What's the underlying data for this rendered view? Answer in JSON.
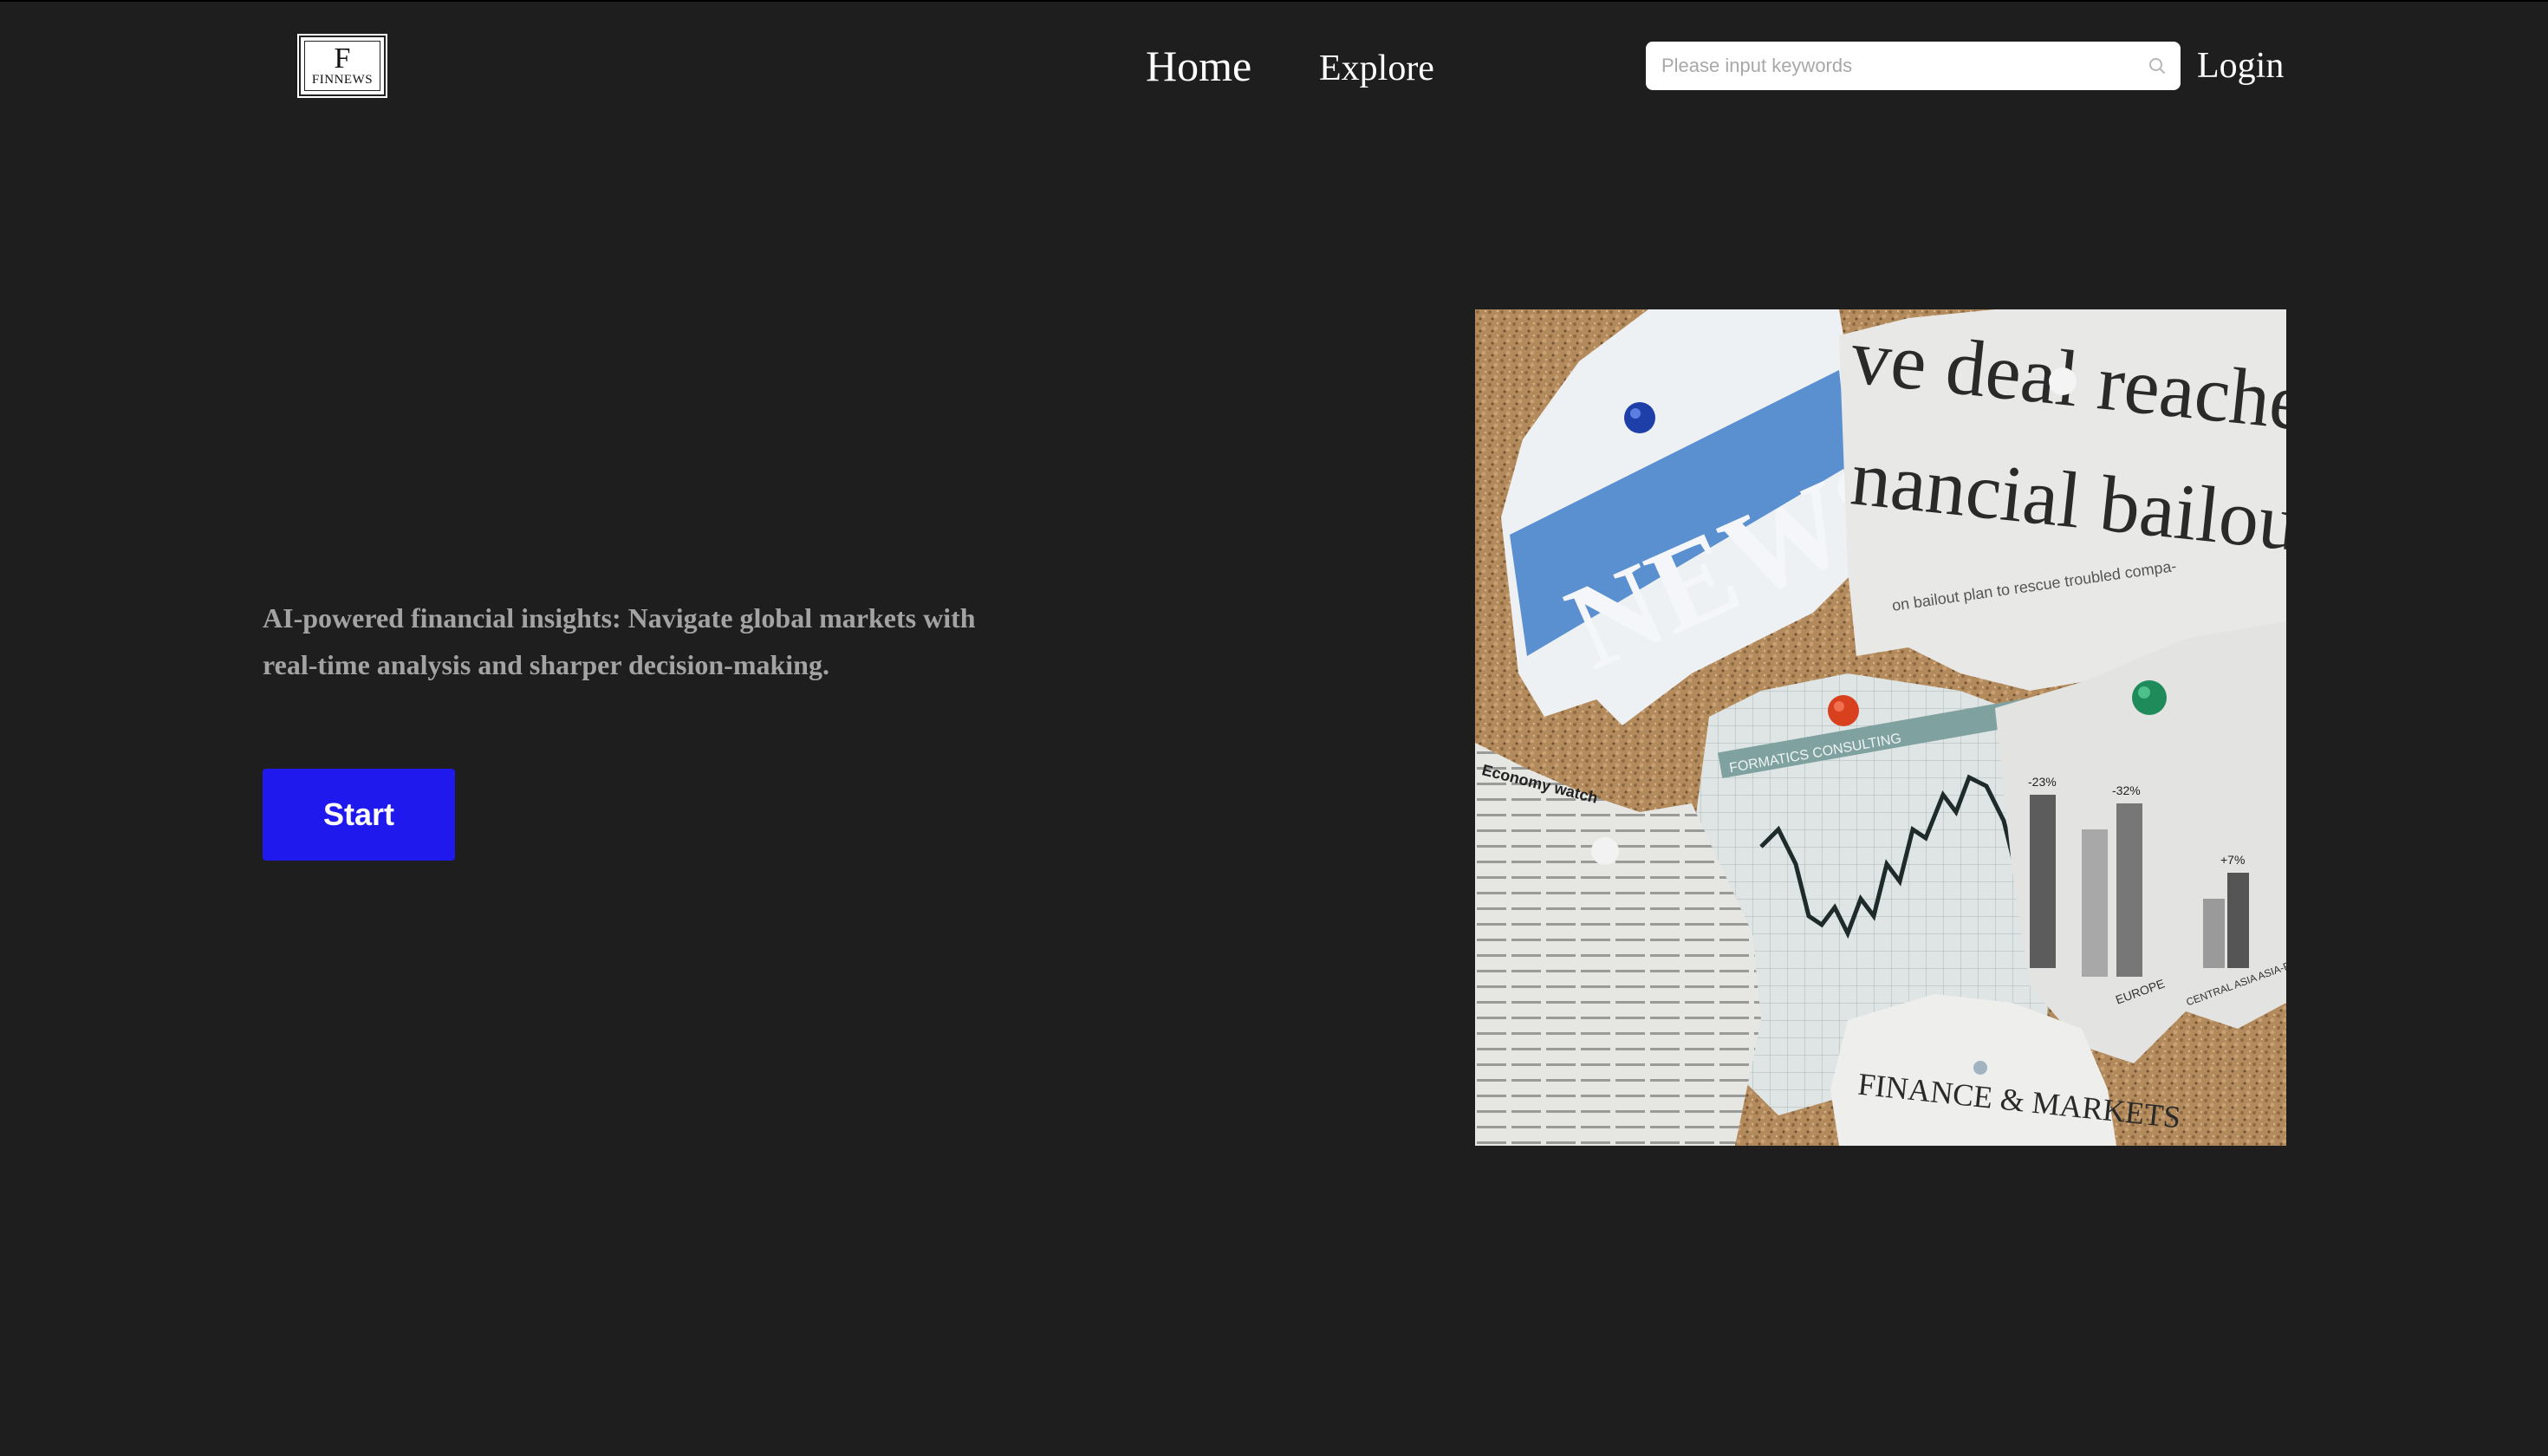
{
  "header": {
    "logo": {
      "letter": "F",
      "text": "FINNEWS"
    },
    "nav": {
      "home": "Home",
      "explore": "Explore"
    },
    "search": {
      "placeholder": "Please input keywords",
      "value": "",
      "icon": "search-icon"
    },
    "login": "Login"
  },
  "hero": {
    "tagline_line1": "AI-powered financial insights: Navigate global markets with",
    "tagline_line2": "real-time analysis and sharper decision-making.",
    "start_label": "Start",
    "image": {
      "news_word": "NEWS",
      "headline_line1": "ve deal reached",
      "headline_line2": "nancial bailou",
      "subheadline": "on bailout plan to rescue troubled compa-",
      "chart_tag": "FORMATICS CONSULTING",
      "finance_markets": "FINANCE & MARKETS",
      "economy_watch": "Economy watch",
      "bar_labels": [
        "EUROPE",
        "CENTRAL ASIA ASIA-PACIFIC"
      ],
      "bar_pcts": [
        "-23%",
        "-32%",
        "+7%"
      ]
    }
  },
  "colors": {
    "background": "#1e1e1e",
    "accent": "#2019ee",
    "text_muted": "#a3a3a3"
  }
}
